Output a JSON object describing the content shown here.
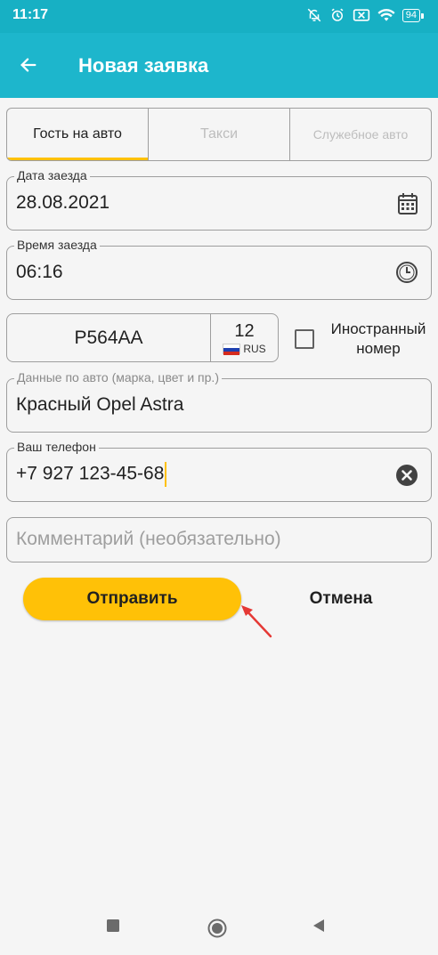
{
  "status_bar": {
    "time": "11:17",
    "battery": "94",
    "icons": [
      "bell-off-icon",
      "alarm-icon",
      "sim-off-icon",
      "wifi-icon",
      "battery-icon"
    ]
  },
  "app_bar": {
    "title": "Новая заявка",
    "back_icon": "arrow-back-icon"
  },
  "tabs": [
    {
      "label": "Гость на авто",
      "active": true
    },
    {
      "label": "Такси",
      "active": false
    },
    {
      "label": "Служебное авто",
      "active": false
    }
  ],
  "form": {
    "date": {
      "label": "Дата заезда",
      "value": "28.08.2021",
      "icon": "calendar-icon"
    },
    "time": {
      "label": "Время заезда",
      "value": "06:16",
      "icon": "clock-icon"
    },
    "plate": {
      "number": "Р564АА",
      "region": "12",
      "country": "RUS"
    },
    "foreign": {
      "label": "Иностранный номер",
      "checked": false
    },
    "car_details": {
      "label": "Данные по авто (марка, цвет и пр.)",
      "value": "Красный Opel Astra"
    },
    "phone": {
      "label": "Ваш телефон",
      "value": "+7 927 123-45-68",
      "clear_icon": "clear-icon"
    },
    "comment": {
      "placeholder": "Комментарий (необязательно)"
    }
  },
  "actions": {
    "submit": "Отправить",
    "cancel": "Отмена"
  },
  "colors": {
    "primary": "#1db6cc",
    "status": "#17b0c4",
    "accent": "#ffc107",
    "annotation": "#e53935"
  },
  "nav": [
    "recents-icon",
    "home-icon",
    "back-icon"
  ]
}
